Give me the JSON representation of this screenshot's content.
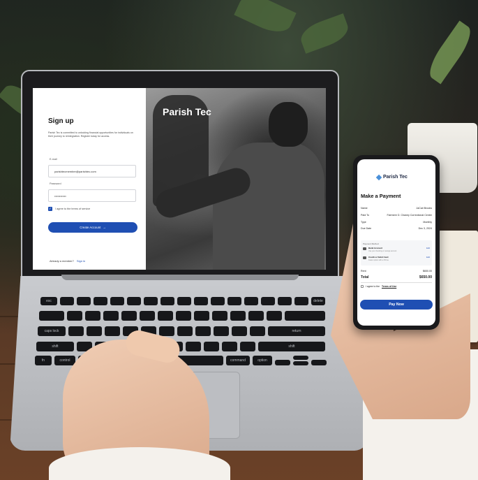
{
  "signup": {
    "title": "Sign up",
    "description": "Parish Tec is committed to unlocking financial opportunities for individuals on their journey to reintegration. Register today for access.",
    "email_label": "E-mail",
    "email_value": "parishtecmember@parishtec.com",
    "password_label": "Password",
    "password_value": "••••••••••••",
    "terms_label": "I agree to the terms of service",
    "terms_checked": true,
    "create_button_label": "Create Account",
    "create_button_arrow": "→",
    "already_member_label": "Already a member?",
    "sign_in_label": "Sign in"
  },
  "photo": {
    "brand": "Parish Tec"
  },
  "phone": {
    "brand": "Parish Tec",
    "title": "Make a Payment",
    "details": [
      {
        "label": "Name",
        "value": "JaCari Brooks"
      },
      {
        "label": "Paid To",
        "value": "Fairmere D. Chaney Correctional Center"
      },
      {
        "label": "Type",
        "value": "Monthly"
      },
      {
        "label": "Due Date",
        "value": "Dec 3, 2024"
      }
    ],
    "payment_method": {
      "heading": "Payment Method",
      "items": [
        {
          "name": "Bank Account",
          "sub": "Use your checking or savings account",
          "action": "Edit"
        },
        {
          "name": "Credit or Debit Card",
          "sub": "Faster option with a 3% fee",
          "action": "Edit"
        }
      ]
    },
    "rent_label": "Rent",
    "rent_value": "$650.00",
    "total_label": "Total",
    "total_value": "$650.00",
    "agree_prefix": "I agree to the",
    "agree_link": "Terms of Use",
    "pay_button_label": "Pay Now"
  },
  "keyboard": {
    "keys": [
      "esc",
      "caps lock",
      "shift",
      "fn",
      "control",
      "option",
      "command",
      "command",
      "option",
      "delete",
      "return",
      "shift"
    ]
  },
  "colors": {
    "accent": "#1f4fb3",
    "brand_diamond": "#4a90d9"
  }
}
